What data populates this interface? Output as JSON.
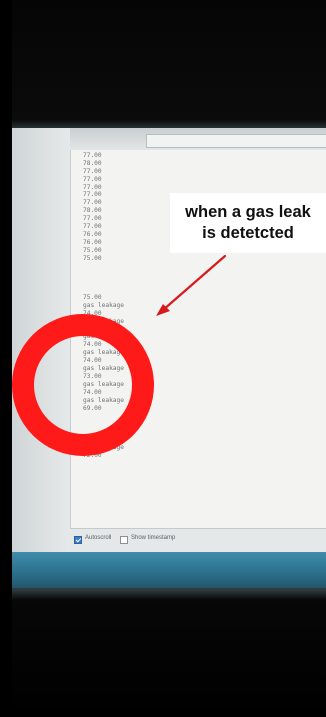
{
  "colors": {
    "ring": "#ff1a1a",
    "arrow": "#d61a1a",
    "serial_text": "#6f7477",
    "checkbox_on": "#3d7cc9"
  },
  "serial_monitor": {
    "lines": [
      "77.00",
      "78.00",
      "77.00",
      "77.00",
      "77.00",
      "77.00",
      "77.00",
      "78.00",
      "77.00",
      "77.00",
      "76.00",
      "76.00",
      "75.00",
      "75.00",
      "",
      "",
      "",
      "",
      "75.00",
      "gas leakage",
      "74.00",
      "gas leakage",
      "74.00",
      "gas leakage",
      "74.00",
      "gas leakage",
      "74.00",
      "gas leakage",
      "73.00",
      "gas leakage",
      "74.00",
      "gas leakage",
      "69.00",
      "",
      "",
      "",
      "71.00",
      "gas leakage",
      "72.00"
    ]
  },
  "bottom_bar": {
    "autoscroll_label": "Autoscroll",
    "autoscroll_checked": true,
    "timestamp_label": "Show timestamp",
    "timestamp_checked": false
  },
  "annotation": {
    "text": "when a gas leak\nis detetcted",
    "icon": "red-arrow-icon",
    "highlight": "red-circle-highlight"
  }
}
